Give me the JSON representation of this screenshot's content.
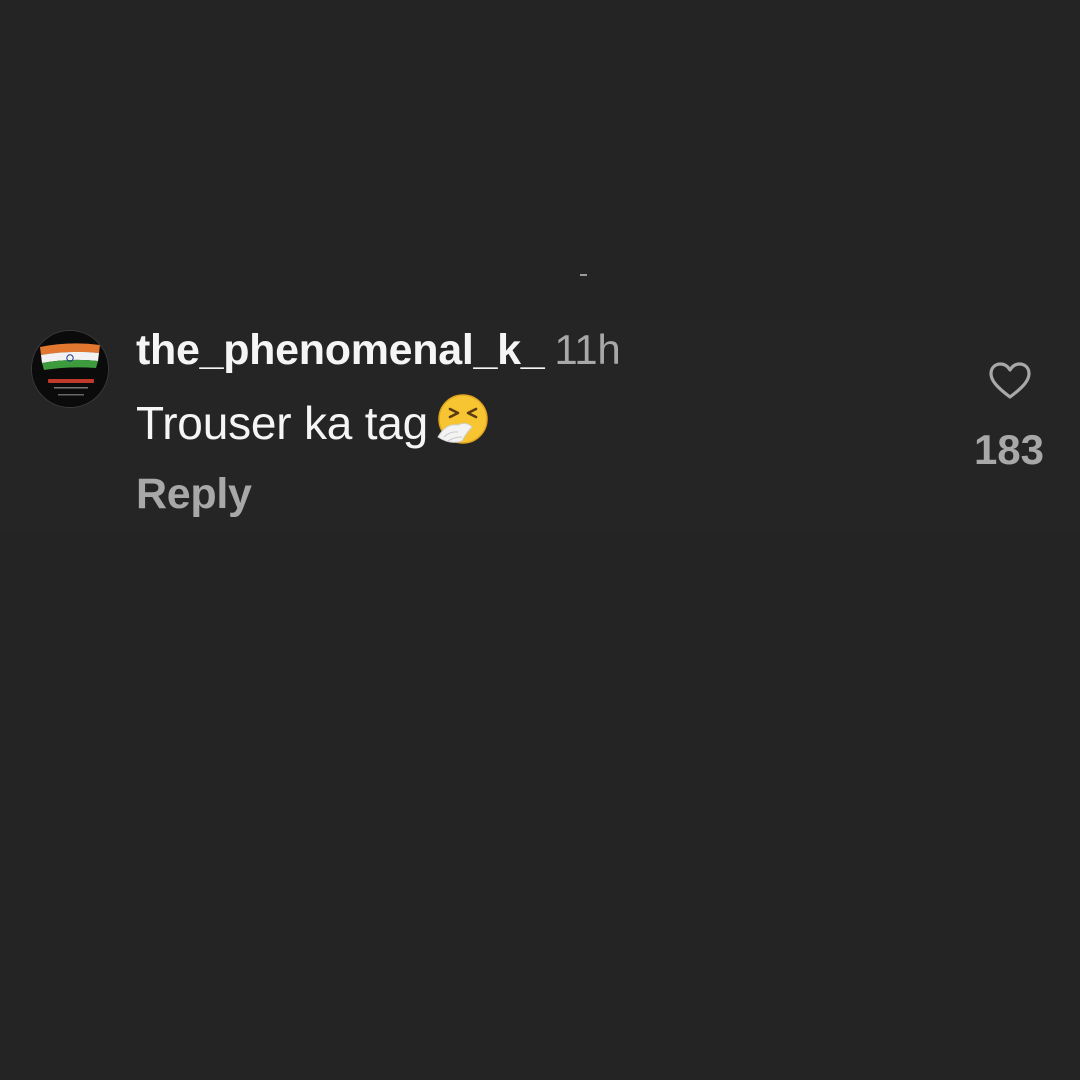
{
  "comment": {
    "username": "the_phenomenal_k_",
    "timestamp": "11h",
    "text": "Trouser ka tag",
    "emoji": "sneezing-face",
    "reply_label": "Reply",
    "like_count": "183",
    "like_icon": "heart-outline-icon",
    "avatar": {
      "description_icon": "india-flag-icon"
    }
  },
  "colors": {
    "background": "#242424",
    "primary_text": "#f5f5f5",
    "secondary_text": "#a8a8a8"
  }
}
